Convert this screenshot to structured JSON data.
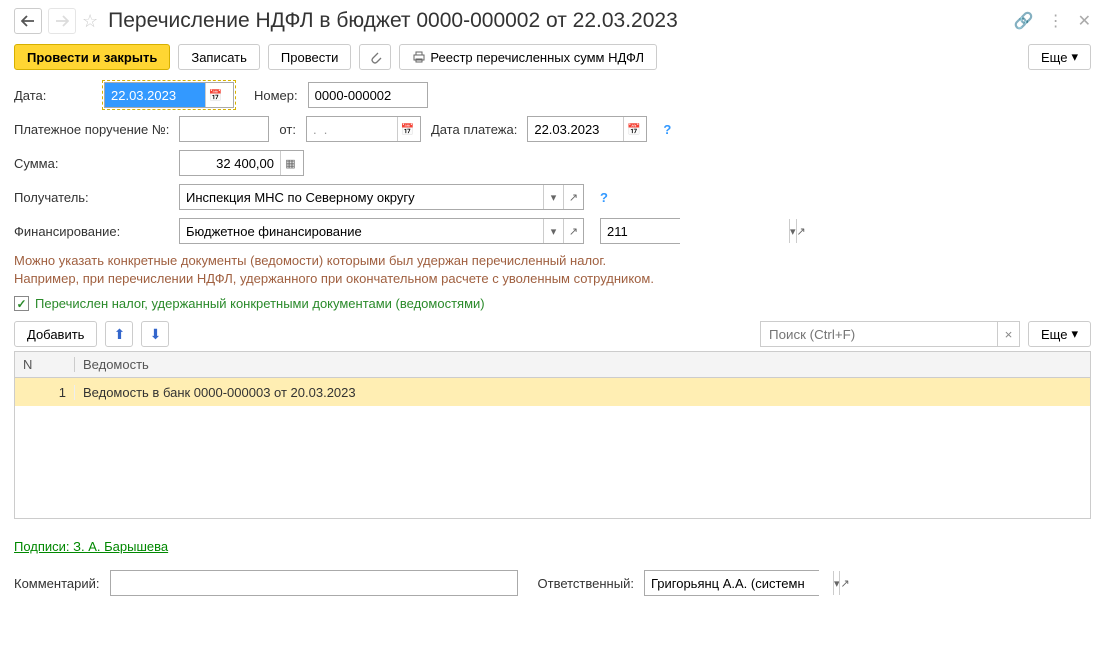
{
  "header": {
    "title": "Перечисление НДФЛ в бюджет 0000-000002 от 22.03.2023"
  },
  "toolbar": {
    "submit": "Провести и закрыть",
    "save": "Записать",
    "post": "Провести",
    "registry": "Реестр перечисленных сумм НДФЛ",
    "more": "Еще"
  },
  "fields": {
    "date_label": "Дата:",
    "date_value": "22.03.2023",
    "number_label": "Номер:",
    "number_value": "0000-000002",
    "order_label": "Платежное поручение №:",
    "order_value": "",
    "from_label": "от:",
    "from_value": ".  .    ",
    "payment_date_label": "Дата платежа:",
    "payment_date_value": "22.03.2023",
    "sum_label": "Сумма:",
    "sum_value": "32 400,00",
    "recipient_label": "Получатель:",
    "recipient_value": "Инспекция МНС по Северному округу",
    "financing_label": "Финансирование:",
    "financing_value": "Бюджетное финансирование",
    "code_value": "211"
  },
  "hint": {
    "line1": "Можно указать конкретные документы (ведомости) которыми был удержан перечисленный налог.",
    "line2": "Например, при перечислении НДФЛ, удержанного при окончательном расчете с уволенным сотрудником."
  },
  "checkbox": {
    "label": "Перечислен налог, удержанный конкретными документами (ведомостями)"
  },
  "table": {
    "add": "Добавить",
    "search_placeholder": "Поиск (Ctrl+F)",
    "more": "Еще",
    "col_n": "N",
    "col_vedomost": "Ведомость",
    "rows": [
      {
        "n": "1",
        "vedomost": "Ведомость в банк 0000-000003 от 20.03.2023"
      }
    ]
  },
  "signature": "Подписи: З. А. Барышева",
  "bottom": {
    "comment_label": "Комментарий:",
    "comment_value": "",
    "responsible_label": "Ответственный:",
    "responsible_value": "Григорьянц А.А. (системн"
  }
}
